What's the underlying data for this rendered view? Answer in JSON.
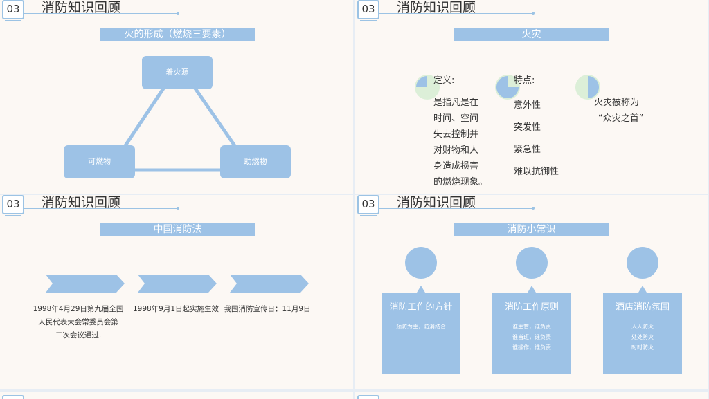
{
  "slides": [
    {
      "num": "03",
      "title": "消防知识回顾",
      "banner": "火的形成（燃烧三要素）",
      "nodes": {
        "ignition": "着火源",
        "fuel": "可燃物",
        "oxidizer": "助燃物"
      }
    },
    {
      "num": "03",
      "title": "消防知识回顾",
      "banner": "火灾",
      "columns": [
        {
          "heading": "定义:",
          "lines": [
            "是指凡是在",
            "时间、空间",
            "失去控制并",
            "对财物和人",
            "身造成损害",
            "的燃烧现象。"
          ]
        },
        {
          "heading": "特点:",
          "lines": [
            "意外性",
            "突发性",
            "紧急性",
            "难以抗御性"
          ]
        },
        {
          "heading": "",
          "lines": [
            "火灾被称为",
            "“众灾之首”"
          ]
        }
      ]
    },
    {
      "num": "03",
      "title": "消防知识回顾",
      "banner": "中国消防法",
      "timeline": [
        {
          "lines": [
            "1998年4月29日第九届全国",
            "人民代表大会常委员会第",
            "二次会议通过."
          ]
        },
        {
          "lines": [
            "1998年9月1日起实施生效"
          ]
        },
        {
          "lines": [
            "我国消防宣传日：11月9日"
          ]
        }
      ]
    },
    {
      "num": "03",
      "title": "消防知识回顾",
      "banner": "消防小常识",
      "cards": [
        {
          "title": "消防工作的方针",
          "body": [
            "预防为主，防消结合"
          ]
        },
        {
          "title": "消防工作原则",
          "body": [
            "谁主管，谁负责",
            "谁当班，谁负责",
            "谁操作，谁负责"
          ]
        },
        {
          "title": "酒店消防氛围",
          "body": [
            "人人防火",
            "处处防火",
            "时时防火"
          ]
        }
      ]
    }
  ],
  "colors": {
    "accent": "#9dc2e6",
    "pie_green": "#dcefd8",
    "background": "#fcf8f4"
  }
}
